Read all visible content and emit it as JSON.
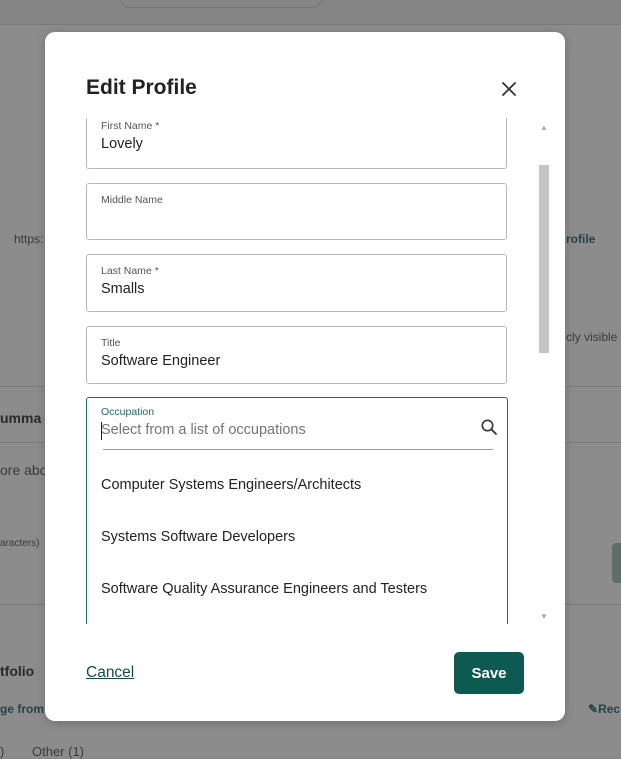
{
  "background": {
    "url_fragment": "https:",
    "profile_fragment": "rofile",
    "visible_fragment": "cly visible",
    "summary_fragment": "umma",
    "about_fragment": "ore abo",
    "chars_fragment": "aracters)",
    "portfolio_fragment": "tfolio",
    "image_fragment": "ge from",
    "rec_fragment": "Rec",
    "tab_fragment_1": ")",
    "tab_fragment_2": "Other (1)"
  },
  "modal": {
    "title": "Edit Profile",
    "close_icon": "close-icon",
    "fields": {
      "first_name": {
        "label": "First Name *",
        "value": "Lovely"
      },
      "middle_name": {
        "label": "Middle Name",
        "value": ""
      },
      "last_name": {
        "label": "Last Name *",
        "value": "Smalls"
      },
      "title": {
        "label": "Title",
        "value": "Software Engineer"
      }
    },
    "occupation": {
      "label": "Occupation",
      "placeholder": "Select from a list of occupations",
      "search_icon": "search-icon",
      "options": [
        "Computer Systems Engineers/Architects",
        "Systems Software Developers",
        "Software Quality Assurance Engineers and Testers"
      ]
    },
    "cancel_label": "Cancel",
    "save_label": "Save"
  },
  "colors": {
    "accent": "#0d5a50",
    "focus_border": "#1f6a5e",
    "overlay": "#8c8c8c"
  }
}
